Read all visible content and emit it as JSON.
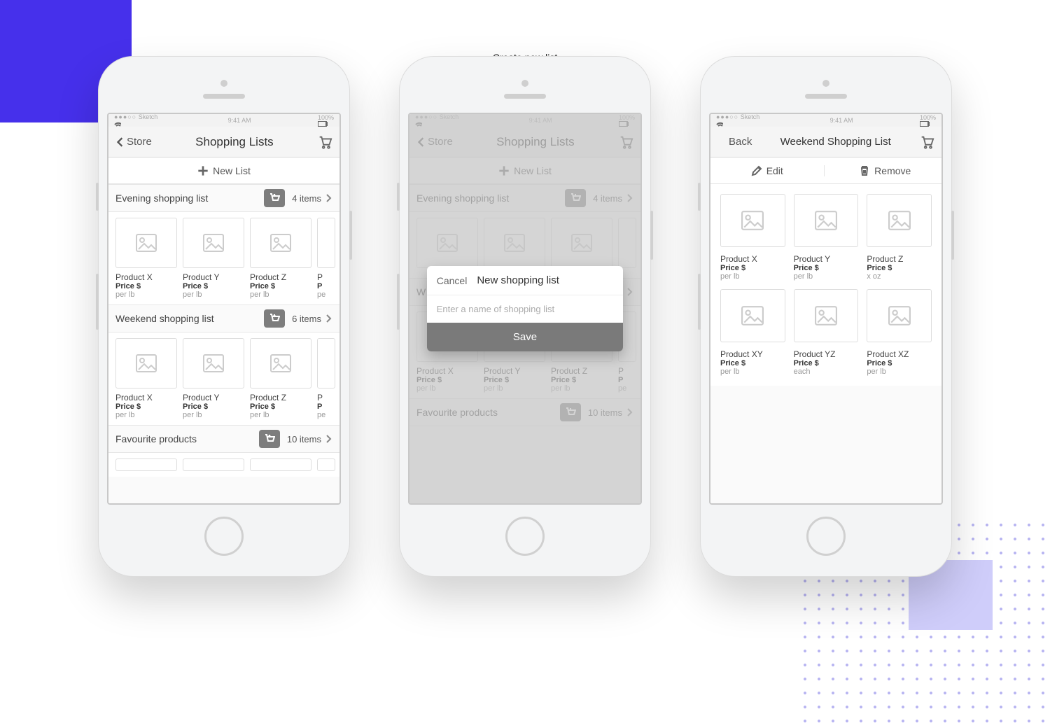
{
  "overtext": "Create new list",
  "status": {
    "carrier": "Sketch",
    "signal": "●●●○○",
    "time": "9:41 AM",
    "battery": "100%"
  },
  "screen1": {
    "back": "Store",
    "title": "Shopping Lists",
    "newlist": "New List",
    "lists": [
      {
        "name": "Evening shopping list",
        "count": "4 items",
        "products": [
          {
            "name": "Product X",
            "price": "Price $",
            "unit": "per lb"
          },
          {
            "name": "Product Y",
            "price": "Price $",
            "unit": "per lb"
          },
          {
            "name": "Product Z",
            "price": "Price $",
            "unit": "per lb"
          },
          {
            "name": "P",
            "price": "P",
            "unit": "pe"
          }
        ]
      },
      {
        "name": "Weekend shopping list",
        "count": "6 items",
        "products": [
          {
            "name": "Product X",
            "price": "Price $",
            "unit": "per lb"
          },
          {
            "name": "Product Y",
            "price": "Price $",
            "unit": "per lb"
          },
          {
            "name": "Product Z",
            "price": "Price $",
            "unit": "per lb"
          },
          {
            "name": "P",
            "price": "P",
            "unit": "pe"
          }
        ]
      },
      {
        "name": "Favourite products",
        "count": "10 items",
        "products": []
      }
    ]
  },
  "screen2": {
    "back": "Store",
    "title": "Shopping Lists",
    "newlist": "New List",
    "lists": [
      {
        "name": "Evening shopping list",
        "count": "4 items",
        "products": [
          {
            "name": "",
            "price": "",
            "unit": ""
          },
          {
            "name": "",
            "price": "",
            "unit": ""
          },
          {
            "name": "",
            "price": "",
            "unit": ""
          },
          {
            "name": "",
            "price": "",
            "unit": ""
          }
        ]
      },
      {
        "name": "W",
        "count": "",
        "products": [
          {
            "name": "Product X",
            "price": "Price $",
            "unit": "per lb"
          },
          {
            "name": "Product Y",
            "price": "Price $",
            "unit": "per lb"
          },
          {
            "name": "Product Z",
            "price": "Price $",
            "unit": "per lb"
          },
          {
            "name": "P",
            "price": "P",
            "unit": "pe"
          }
        ]
      },
      {
        "name": "Favourite products",
        "count": "10 items",
        "products": []
      }
    ],
    "modal": {
      "cancel": "Cancel",
      "title": "New shopping list",
      "placeholder": "Enter a name of shopping list",
      "save": "Save"
    }
  },
  "screen3": {
    "back": "Back",
    "title": "Weekend Shopping List",
    "edit": "Edit",
    "remove": "Remove",
    "products": [
      {
        "name": "Product X",
        "price": "Price $",
        "unit": "per lb"
      },
      {
        "name": "Product Y",
        "price": "Price $",
        "unit": "per lb"
      },
      {
        "name": "Product Z",
        "price": "Price $",
        "unit": "x oz"
      },
      {
        "name": "Product XY",
        "price": "Price $",
        "unit": "per lb"
      },
      {
        "name": "Product YZ",
        "price": "Price $",
        "unit": "each"
      },
      {
        "name": "Product XZ",
        "price": "Price $",
        "unit": "per lb"
      }
    ]
  }
}
